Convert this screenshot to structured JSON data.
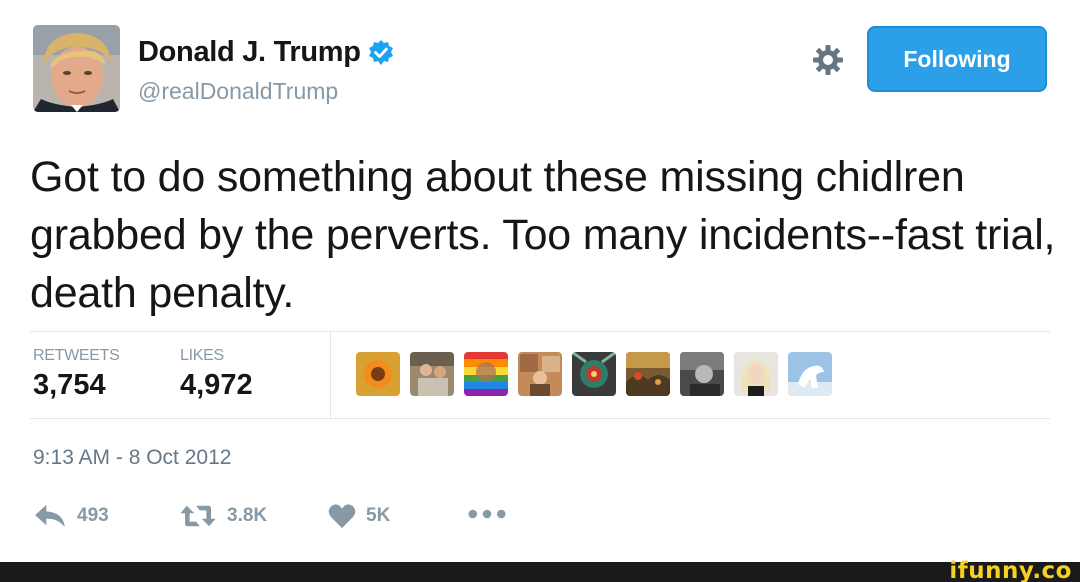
{
  "user": {
    "name": "Donald J. Trump",
    "handle": "@realDonaldTrump",
    "verified": true,
    "verified_color": "#1da1f2"
  },
  "follow_button": {
    "label": "Following",
    "color": "#2b9fe8"
  },
  "tweet": {
    "text": "Got to do something about these missing chidlren grabbed by the perverts. Too many incidents--fast trial, death penalty."
  },
  "stats": {
    "retweets_label": "RETWEETS",
    "retweets_value": "3,754",
    "likes_label": "LIKES",
    "likes_value": "4,972"
  },
  "likers": [
    {
      "icon": "avatar-sunflower"
    },
    {
      "icon": "avatar-couple-photo"
    },
    {
      "icon": "avatar-rainbow-portrait"
    },
    {
      "icon": "avatar-man-collage"
    },
    {
      "icon": "avatar-tribal-art"
    },
    {
      "icon": "avatar-landscape-painting"
    },
    {
      "icon": "avatar-bw-man"
    },
    {
      "icon": "avatar-blonde-woman"
    },
    {
      "icon": "avatar-white-horse"
    }
  ],
  "timestamp": "9:13 AM - 8 Oct 2012",
  "actions": {
    "reply_count": "493",
    "retweet_count": "3.8K",
    "like_count": "5K",
    "reply_icon": "reply-icon",
    "retweet_icon": "retweet-icon",
    "like_icon": "heart-icon",
    "more_icon": "more-dots-icon"
  },
  "watermark": {
    "text": "ifunny.co",
    "color": "#f7d11e"
  },
  "colors": {
    "text": "#14171a",
    "muted": "#8899a6",
    "divider": "#e1e8ed"
  }
}
